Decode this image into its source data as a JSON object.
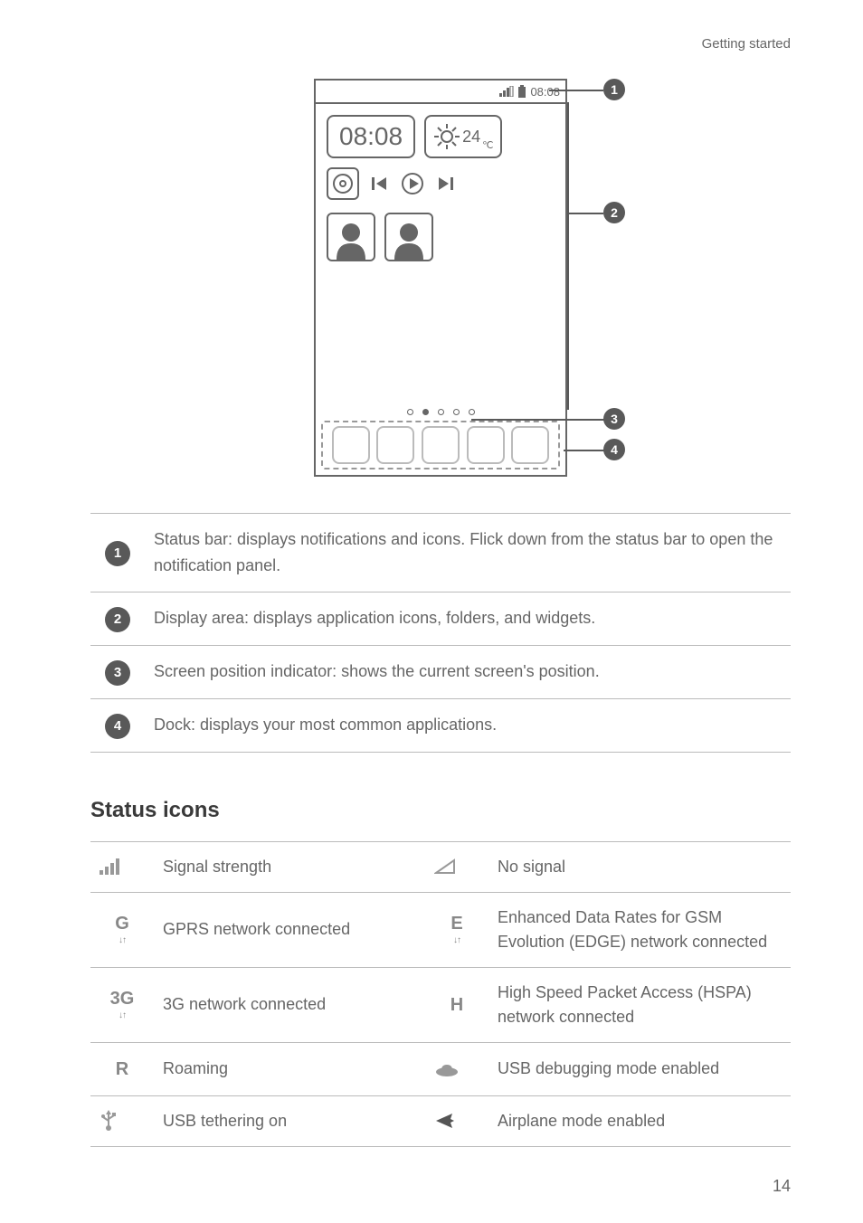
{
  "header": {
    "section": "Getting started"
  },
  "diagram": {
    "status_time": "08:08",
    "clock": "08:08",
    "temp": "24",
    "temp_unit": "℃"
  },
  "callouts": {
    "one": "1",
    "two": "2",
    "three": "3",
    "four": "4"
  },
  "legend": {
    "r1": "Status bar: displays notifications and icons. Flick down from the status bar to open the notification panel.",
    "r2": "Display area: displays application icons, folders, and widgets.",
    "r3": "Screen position indicator: shows the current screen's position.",
    "r4": "Dock: displays your most common applications."
  },
  "section_title": "Status icons",
  "icons": {
    "signal": {
      "label": "Signal strength"
    },
    "nosignal": {
      "label": "No signal"
    },
    "gprs": {
      "letter": "G",
      "label": "GPRS network connected"
    },
    "edge": {
      "letter": "E",
      "label": "Enhanced Data Rates for GSM Evolution (EDGE) network connected"
    },
    "threeg": {
      "letter": "3G",
      "label": "3G network connected"
    },
    "hspa": {
      "letter": "H",
      "label": "High Speed Packet Access (HSPA) network connected"
    },
    "roaming": {
      "letter": "R",
      "label": "Roaming"
    },
    "usbdebug": {
      "label": "USB debugging mode enabled"
    },
    "usbtether": {
      "label": "USB tethering on"
    },
    "airplane": {
      "label": "Airplane mode enabled"
    }
  },
  "page_number": "14"
}
